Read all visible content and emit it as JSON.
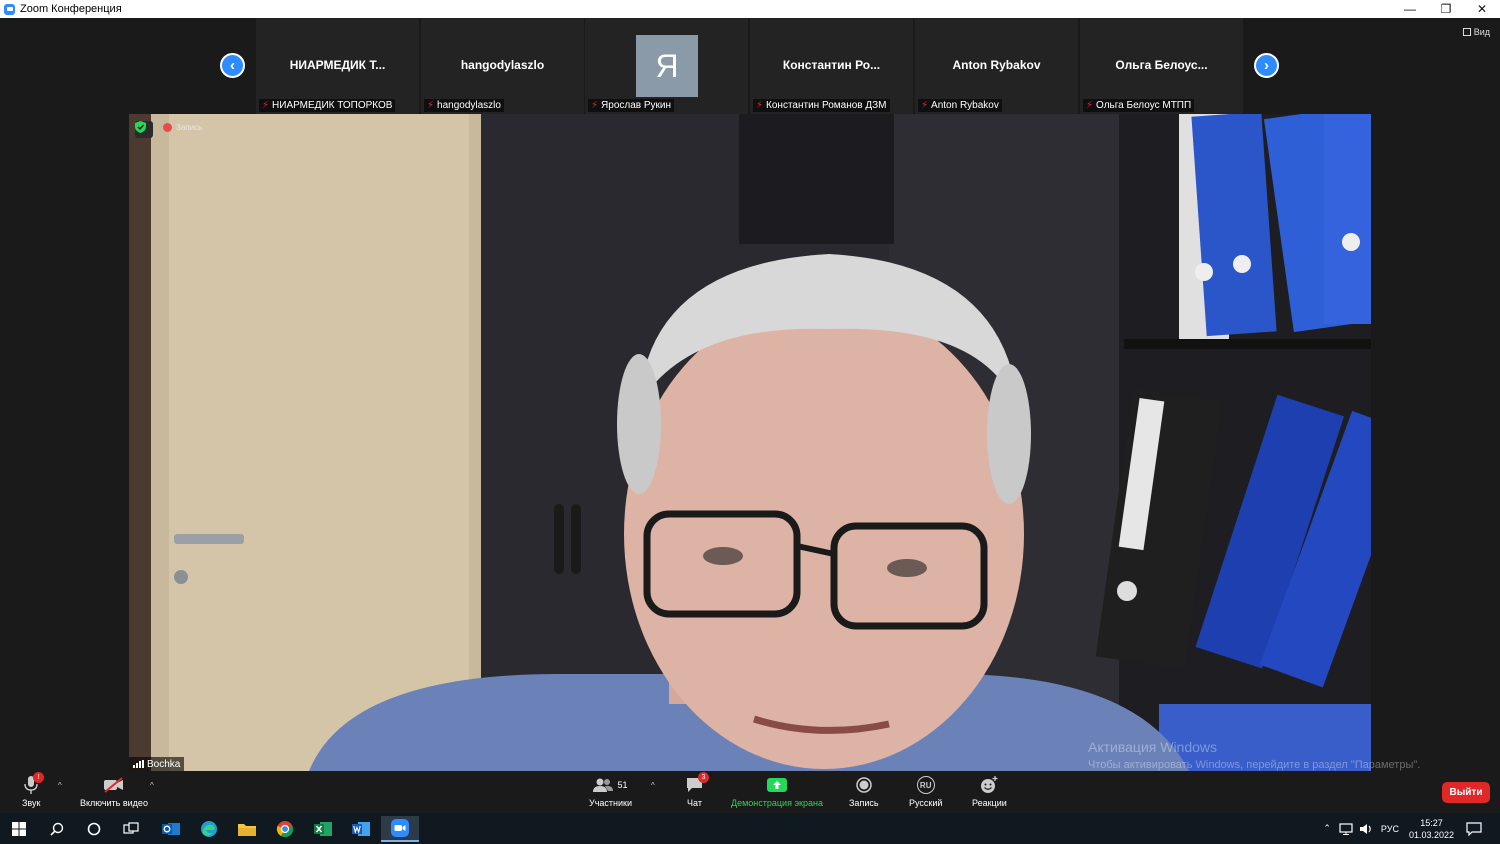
{
  "window": {
    "title": "Zoom Конференция",
    "minimize": "—",
    "restore": "❐",
    "close": "✕"
  },
  "gallery": {
    "prev_icon": "chevron-left-icon",
    "next_icon": "chevron-right-icon",
    "view_label": "Вид",
    "tiles": [
      {
        "display": "НИАРМЕДИК  Т...",
        "label": "НИАРМЕДИК ТОПОРКОВ",
        "avatar": ""
      },
      {
        "display": "hangodylaszlo",
        "label": "hangodylaszlo",
        "avatar": ""
      },
      {
        "display": "",
        "label": "Ярослав Рукин",
        "avatar": "Я"
      },
      {
        "display": "Константин  Ро...",
        "label": "Константин Романов ДЗМ",
        "avatar": ""
      },
      {
        "display": "Anton Rybakov",
        "label": "Anton Rybakov",
        "avatar": ""
      },
      {
        "display": "Ольга  Белоус...",
        "label": "Ольга Белоус МТПП",
        "avatar": ""
      }
    ]
  },
  "main_video": {
    "recording_label": "Запись",
    "speaker_name": "Bochka",
    "watermark_line1": "Активация Windows",
    "watermark_line2": "Чтобы активировать Windows, перейдите в раздел \"Параметры\"."
  },
  "toolbar": {
    "audio_label": "Звук",
    "audio_badge": "!",
    "video_label": "Включить видео",
    "participants_label": "Участники",
    "participants_count": "51",
    "chat_label": "Чат",
    "chat_badge": "3",
    "share_label": "Демонстрация экрана",
    "record_label": "Запись",
    "language_label": "Русский",
    "language_code": "RU",
    "reactions_label": "Реакции",
    "leave_label": "Выйти",
    "accent_green": "#23d959",
    "accent_red": "#e02828"
  },
  "taskbar": {
    "apps": [
      "windows-start-icon",
      "search-icon",
      "cortana-icon",
      "task-view-icon",
      "outlook-icon",
      "edge-icon",
      "file-explorer-icon",
      "chrome-icon",
      "excel-icon",
      "word-icon",
      "zoom-icon"
    ],
    "language": "РУС",
    "time": "15:27",
    "date": "01.03.2022"
  }
}
